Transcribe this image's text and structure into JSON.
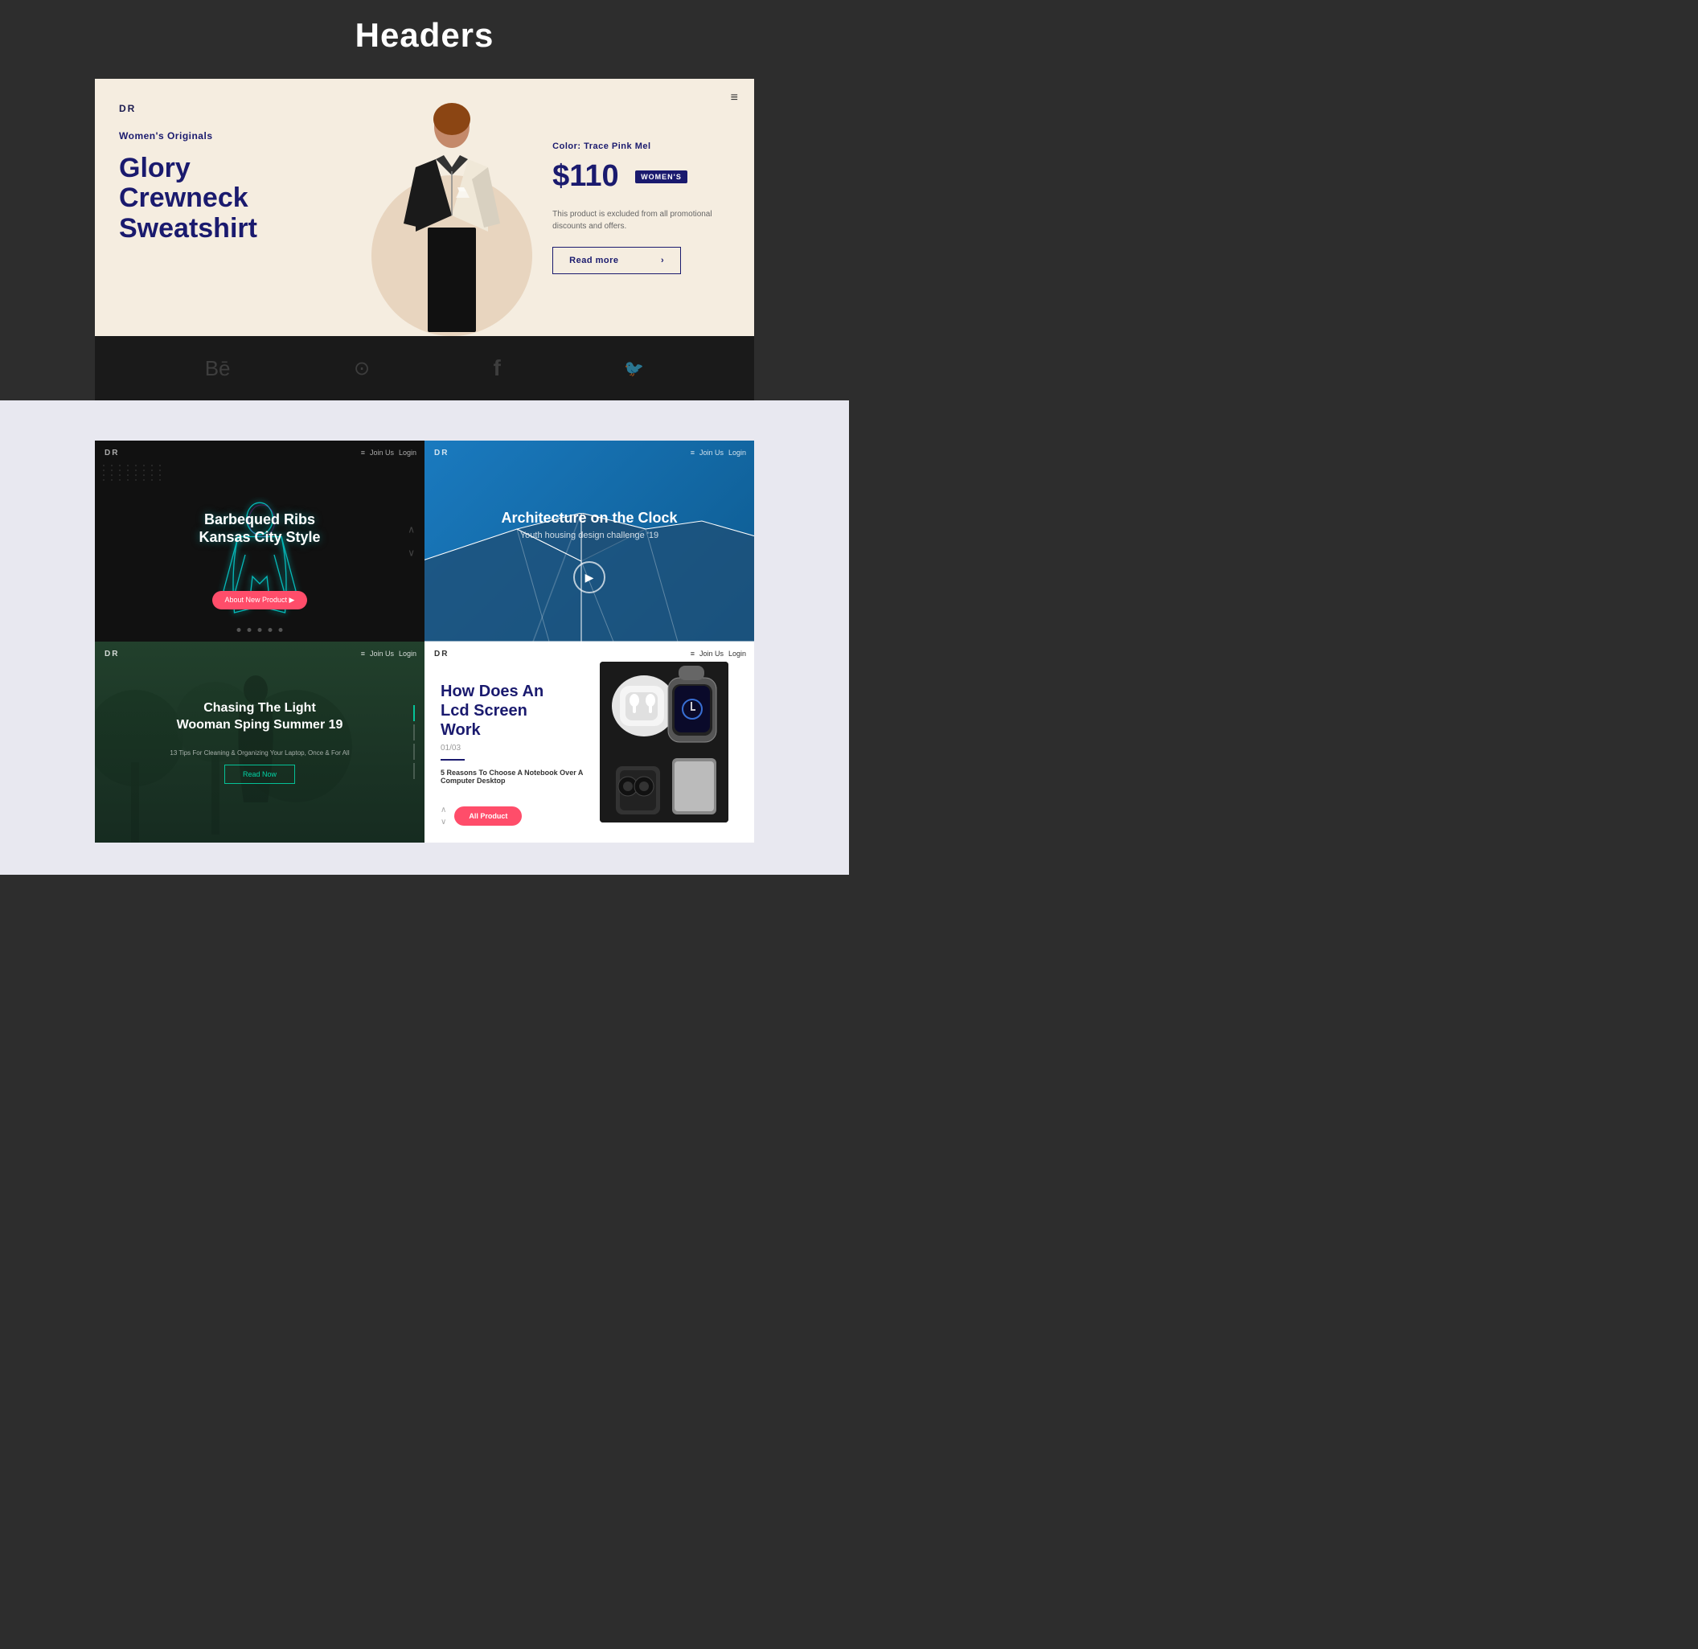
{
  "page": {
    "title": "Headers",
    "background": "#2d2d2d"
  },
  "hero": {
    "logo": "DR",
    "category": "Women's Originals",
    "title_line1": "Glory",
    "title_line2": "Crewneck",
    "title_line3": "Sweatshirt",
    "color_label": "Color: Trace Pink Mel",
    "price": "$110",
    "badge": "WOMEN'S",
    "description": "This product is excluded from all promotional discounts and offers.",
    "read_more": "Read more",
    "menu_icon": "≡",
    "social_icons": [
      "Bē",
      "⊙",
      "f",
      "🐦"
    ]
  },
  "card_bbq": {
    "logo": "DR",
    "title_line1": "Barbequed Ribs",
    "title_line2": "Kansas City Style",
    "button": "About New Product ▶",
    "nav": {
      "join": "Join Us",
      "login": "Login"
    }
  },
  "card_arch": {
    "logo": "DR",
    "title": "Architecture on the Clock",
    "subtitle": "Youth housing design challenge '19",
    "nav": {
      "join": "Join Us",
      "login": "Login"
    }
  },
  "card_photo": {
    "logo": "DR",
    "title_line1": "Chasing The Light",
    "title_line2": "Wooman Sping Summer 19",
    "small_text": "13 Tips For Cleaning & Organizing Your Laptop, Once & For All",
    "button": "Read Now",
    "nav": {
      "join": "Join Us",
      "login": "Login"
    }
  },
  "card_tech": {
    "logo": "DR",
    "title_line1": "How Does An",
    "title_line2": "Lcd Screen",
    "title_line3": "Work",
    "number": "01/03",
    "sub_title": "5 Reasons To Choose A Notebook Over A Computer Desktop",
    "button": "All Product",
    "nav": {
      "join": "Join Us",
      "login": "Login"
    }
  }
}
